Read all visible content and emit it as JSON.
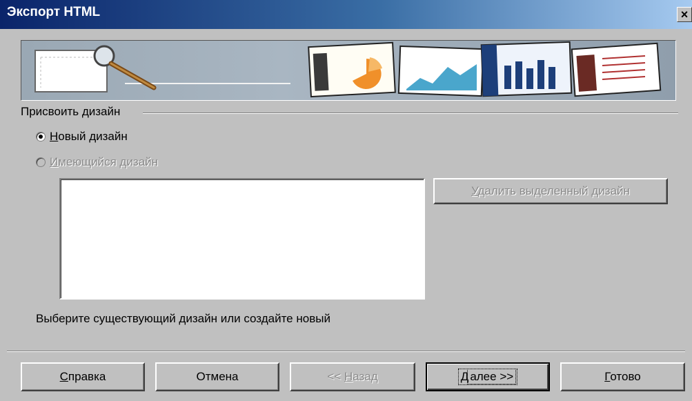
{
  "window": {
    "title": "Экспорт HTML",
    "close_glyph": "×"
  },
  "group": {
    "label": "Присвоить дизайн"
  },
  "options": {
    "new_design": {
      "accel": "Н",
      "rest": "овый дизайн",
      "selected": true
    },
    "existing_design": {
      "accel": "И",
      "rest": "меющийся дизайн",
      "enabled": false
    }
  },
  "design_list": {
    "items": []
  },
  "delete_button": {
    "accel": "У",
    "rest": "далить выделенный дизайн",
    "enabled": false
  },
  "hint": "Выберите существующий дизайн или создайте новый",
  "buttons": {
    "help": {
      "accel": "С",
      "rest": "правка"
    },
    "cancel": {
      "label": "Отмена"
    },
    "back": {
      "prefix": "<< ",
      "accel": "Н",
      "rest": "азад",
      "enabled": false
    },
    "next": {
      "accel": "Д",
      "rest": "алее >>",
      "default": true
    },
    "finish": {
      "accel": "Г",
      "rest": "отово"
    }
  },
  "colors": {
    "titlebar_start": "#0a246a",
    "titlebar_end": "#a6caf0",
    "face": "#c0c0c0"
  }
}
